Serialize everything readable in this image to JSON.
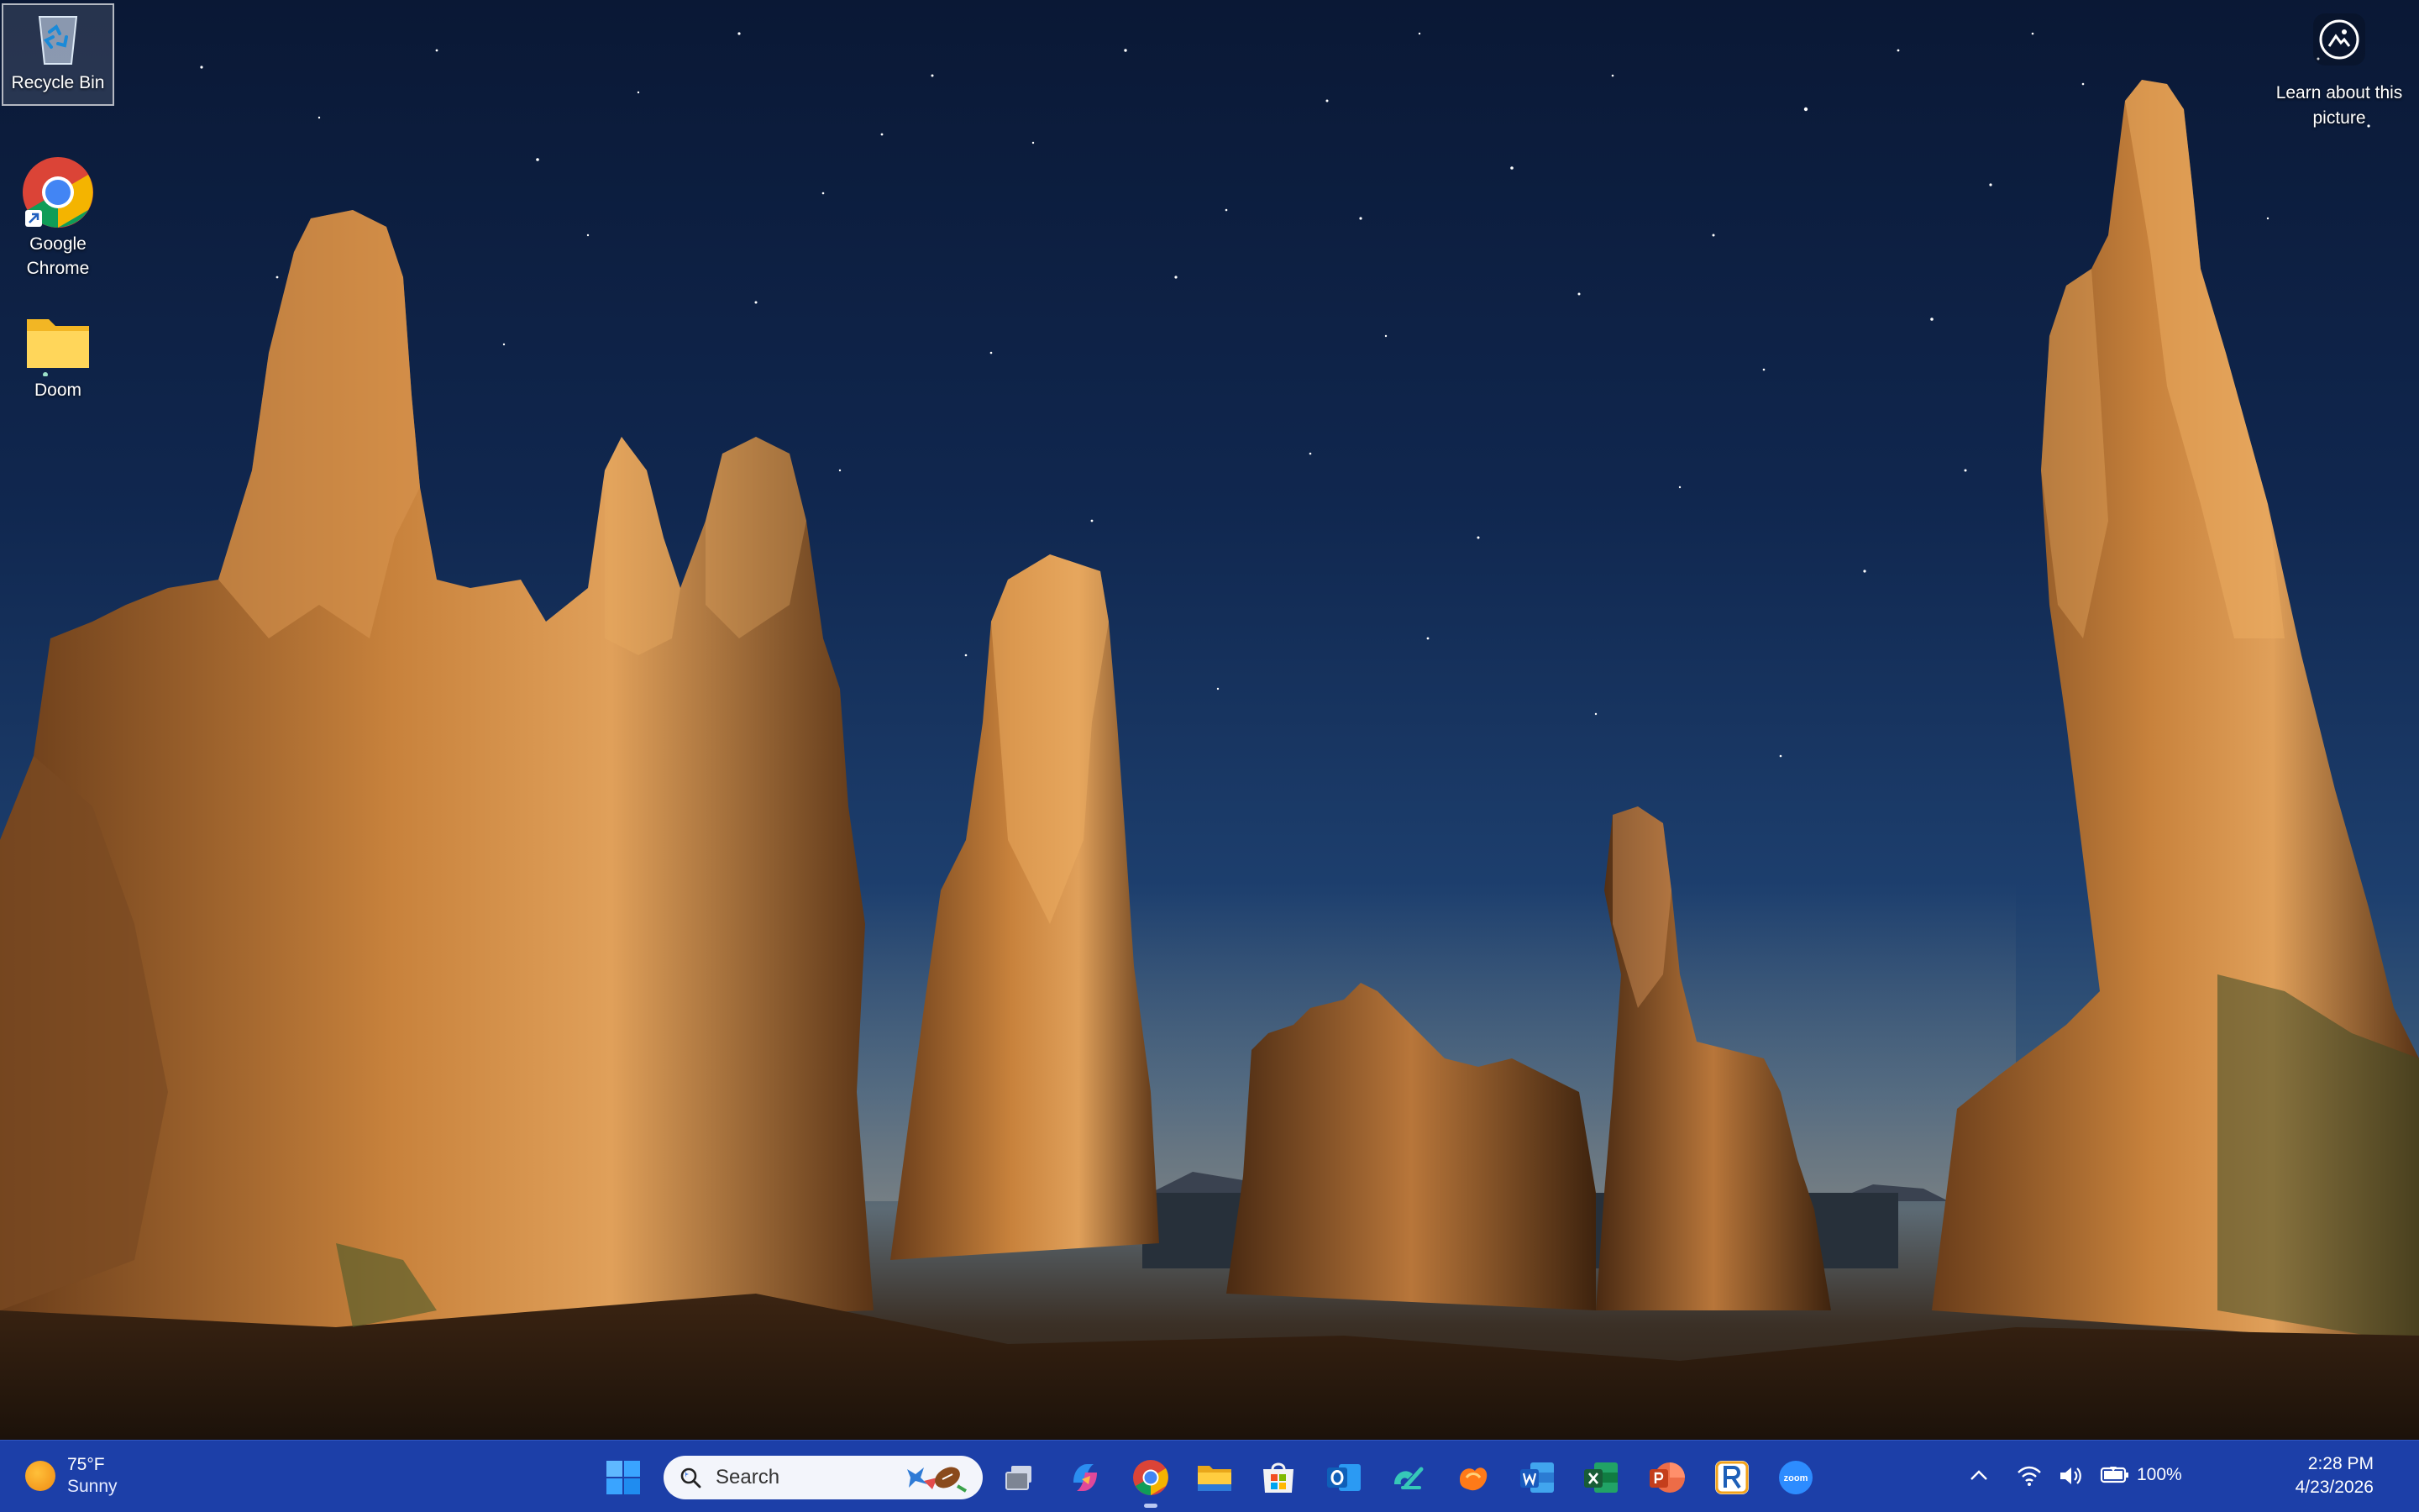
{
  "desktop": {
    "icons": [
      {
        "label": "Recycle Bin",
        "icon": "recycle-bin-icon"
      },
      {
        "label": "Google Chrome",
        "icon": "chrome-icon"
      },
      {
        "label": "Doom",
        "icon": "folder-icon"
      }
    ],
    "learn_about": {
      "label": "Learn about this picture",
      "icon": "camera-icon"
    }
  },
  "taskbar": {
    "weather": {
      "temp": "75°F",
      "condition": "Sunny"
    },
    "search_placeholder": "Search",
    "apps": [
      {
        "name": "Task View",
        "icon": "task-view-icon"
      },
      {
        "name": "Copilot",
        "icon": "copilot-icon"
      },
      {
        "name": "Google Chrome",
        "icon": "chrome-icon",
        "active": true
      },
      {
        "name": "File Explorer",
        "icon": "file-explorer-icon"
      },
      {
        "name": "Microsoft Store",
        "icon": "store-icon"
      },
      {
        "name": "Outlook",
        "icon": "outlook-icon"
      },
      {
        "name": "App",
        "icon": "teal-app-icon"
      },
      {
        "name": "App",
        "icon": "orange-app-icon"
      },
      {
        "name": "Word",
        "icon": "word-icon"
      },
      {
        "name": "Excel",
        "icon": "excel-icon"
      },
      {
        "name": "PowerPoint",
        "icon": "powerpoint-icon"
      },
      {
        "name": "App",
        "icon": "r-app-icon"
      },
      {
        "name": "Zoom",
        "icon": "zoom-icon",
        "label": "zoom"
      }
    ],
    "tray": {
      "battery": "100%",
      "time": "2:28 PM",
      "date": "4/23/2026"
    }
  },
  "colors": {
    "taskbar": "#1c3fa8",
    "search_bg": "#f3f5fb"
  }
}
